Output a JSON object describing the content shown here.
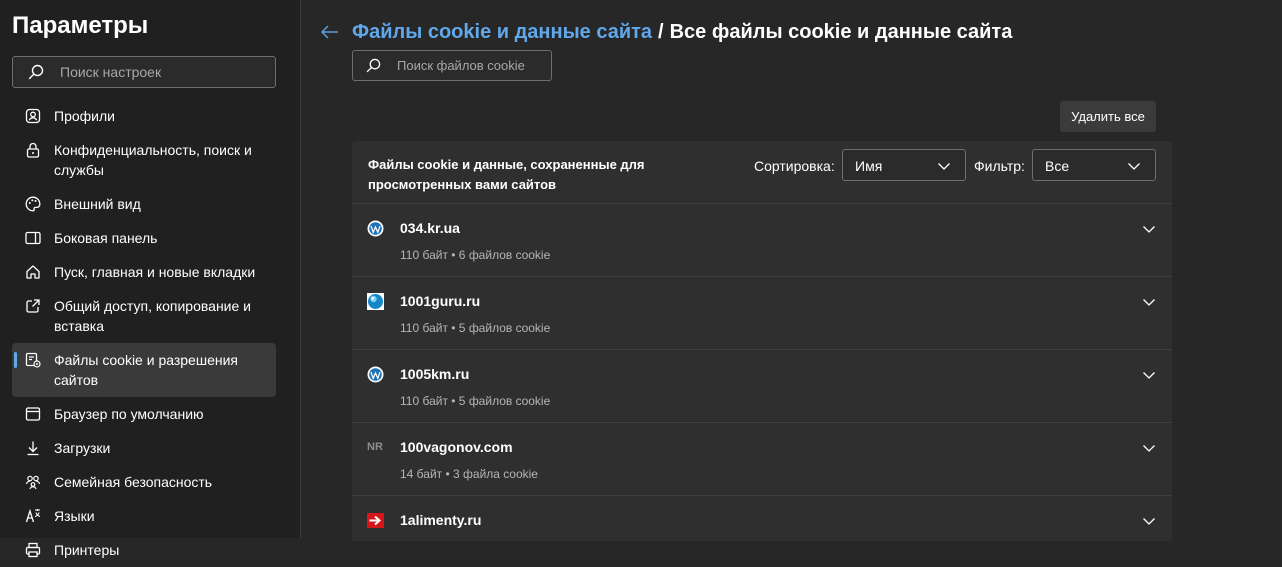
{
  "sidebar": {
    "title": "Параметры",
    "search_placeholder": "Поиск настроек",
    "items": [
      {
        "label": "Профили",
        "icon": "profile-icon"
      },
      {
        "label": "Конфиденциальность, поиск и службы",
        "icon": "lock-icon"
      },
      {
        "label": "Внешний вид",
        "icon": "palette-icon"
      },
      {
        "label": "Боковая панель",
        "icon": "sidebar-panel-icon"
      },
      {
        "label": "Пуск, главная и новые вкладки",
        "icon": "home-icon"
      },
      {
        "label": "Общий доступ, копирование и вставка",
        "icon": "share-icon"
      },
      {
        "label": "Файлы cookie и разрешения сайтов",
        "icon": "cookie-permissions-icon",
        "active": true
      },
      {
        "label": "Браузер по умолчанию",
        "icon": "browser-icon"
      },
      {
        "label": "Загрузки",
        "icon": "download-icon"
      },
      {
        "label": "Семейная безопасность",
        "icon": "family-icon"
      },
      {
        "label": "Языки",
        "icon": "language-icon"
      },
      {
        "label": "Принтеры",
        "icon": "printer-icon"
      }
    ]
  },
  "breadcrumb": {
    "parent": "Файлы cookie и данные сайта",
    "separator": "/",
    "current": "Все файлы cookie и данные сайта"
  },
  "cookie_search_placeholder": "Поиск файлов cookie",
  "delete_all_label": "Удалить все",
  "panel": {
    "header": "Файлы cookie и данные, сохраненные для просмотренных вами сайтов",
    "sort_label": "Сортировка:",
    "sort_value": "Имя",
    "filter_label": "Фильтр:",
    "filter_value": "Все"
  },
  "sites": [
    {
      "name": "034.kr.ua",
      "meta": "110 байт • 6 файлов cookie",
      "favicon": "wordpress-icon"
    },
    {
      "name": "1001guru.ru",
      "meta": "110 байт • 5 файлов cookie",
      "favicon": "globe-icon"
    },
    {
      "name": "1005km.ru",
      "meta": "110 байт • 5 файлов cookie",
      "favicon": "wordpress-icon"
    },
    {
      "name": "100vagonov.com",
      "meta": "14 байт • 3 файла cookie",
      "favicon": "initials-icon",
      "initials": "NR"
    },
    {
      "name": "1alimenty.ru",
      "meta": "",
      "favicon": "red-arrow-icon"
    }
  ],
  "colors": {
    "accent": "#60a8eb",
    "background": "#272727",
    "sidebar": "#202020",
    "panel": "#2f2f2f"
  }
}
